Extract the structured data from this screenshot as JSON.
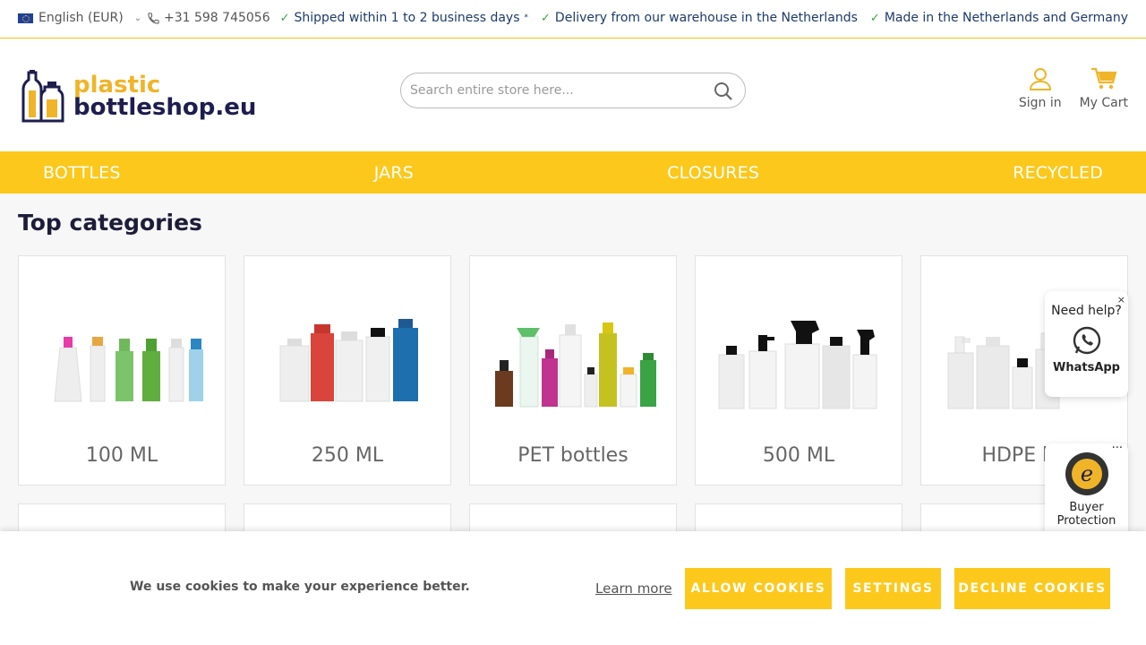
{
  "topbar": {
    "language": "English (EUR)",
    "phone": "+31 598 745056",
    "usps": [
      {
        "text": "Shipped within 1 to 2 business days",
        "sup": "*"
      },
      {
        "text": "Delivery from our warehouse in the Netherlands",
        "sup": ""
      },
      {
        "text": "Made in the Netherlands and Germany",
        "sup": ""
      }
    ]
  },
  "header": {
    "logo_line1": "plastic",
    "logo_line2": "bottleshop.eu",
    "search_placeholder": "Search entire store here...",
    "sign_in": "Sign in",
    "cart": "My Cart"
  },
  "nav": [
    "BOTTLES",
    "JARS",
    "CLOSURES",
    "RECYCLED"
  ],
  "main": {
    "title": "Top categories",
    "categories": [
      "100 ML",
      "250 ML",
      "PET bottles",
      "500 ML",
      "HDPE bo"
    ]
  },
  "help": {
    "title": "Need help?",
    "whatsapp": "WhatsApp",
    "close": "×"
  },
  "trust": {
    "line1": "Buyer",
    "line2": "Protection",
    "menu": "···"
  },
  "cookie": {
    "message": "We use cookies to make your experience better.",
    "learn_more": "Learn more",
    "allow": "ALLOW COOKIES",
    "settings": "SETTINGS",
    "decline": "DECLINE COOKIES"
  },
  "colors": {
    "accent": "#fcc81b",
    "navy": "#1d1d4f",
    "check": "#3aa344"
  }
}
